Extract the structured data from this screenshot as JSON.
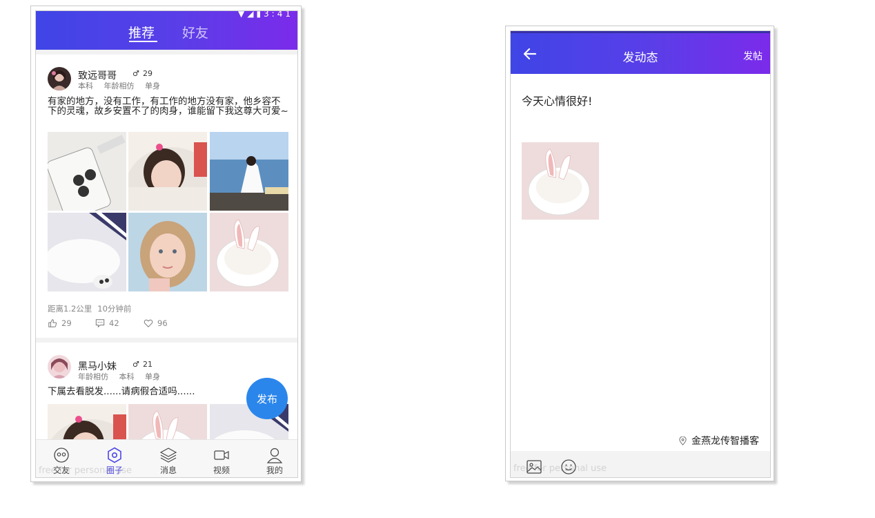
{
  "left_screen": {
    "status_icons": "▼◢▮3:41",
    "tabs": [
      {
        "label": "推荐",
        "active": true
      },
      {
        "label": "好友",
        "active": false
      }
    ],
    "posts": [
      {
        "username": "致远哥哥",
        "gender_icon": "male-icon",
        "age": "29",
        "tags": [
          "本科",
          "年龄相仿",
          "单身"
        ],
        "text": "有家的地方，没有工作，有工作的地方没有家，他乡容不下的灵魂，故乡安置不了的肉身，谁能留下我这尊大可爱~",
        "photos": [
          "phone-case-photo",
          "girl-blanket-photo",
          "girl-beach-photo",
          "sleeping-dog-photo",
          "girl-portrait-photo",
          "bunny-cup-photo"
        ],
        "distance": "距离1.2公里",
        "time": "10分钟前",
        "likes": "29",
        "comments": "42",
        "favorites": "96"
      },
      {
        "username": "黑马小妹",
        "gender_icon": "male-icon",
        "age": "21",
        "tags": [
          "年龄相仿",
          "本科",
          "单身"
        ],
        "text": "下属去看脱发......请病假合适吗......",
        "photos": [
          "girl-blanket-photo",
          "bunny-cup-photo",
          "sleeping-dog-photo"
        ]
      }
    ],
    "fab_label": "发布",
    "bottom_nav": [
      {
        "label": "交友",
        "icon": "chat-face-icon",
        "active": false
      },
      {
        "label": "圈子",
        "icon": "hexagon-icon",
        "active": true
      },
      {
        "label": "消息",
        "icon": "layers-icon",
        "active": false
      },
      {
        "label": "视频",
        "icon": "video-icon",
        "active": false
      },
      {
        "label": "我的",
        "icon": "user-icon",
        "active": false
      }
    ],
    "watermark": "free for personal use"
  },
  "right_screen": {
    "title": "发动态",
    "publish_label": "发帖",
    "post_text": "今天心情很好!",
    "attached_image": "bunny-cup-photo",
    "location": "金燕龙传智播客",
    "watermark": "free for personal use"
  },
  "colors": {
    "header_gradient_start": "#3f45e6",
    "header_gradient_end": "#7b2bea",
    "fab": "#2b86ec",
    "active_nav": "#4c45e6"
  }
}
